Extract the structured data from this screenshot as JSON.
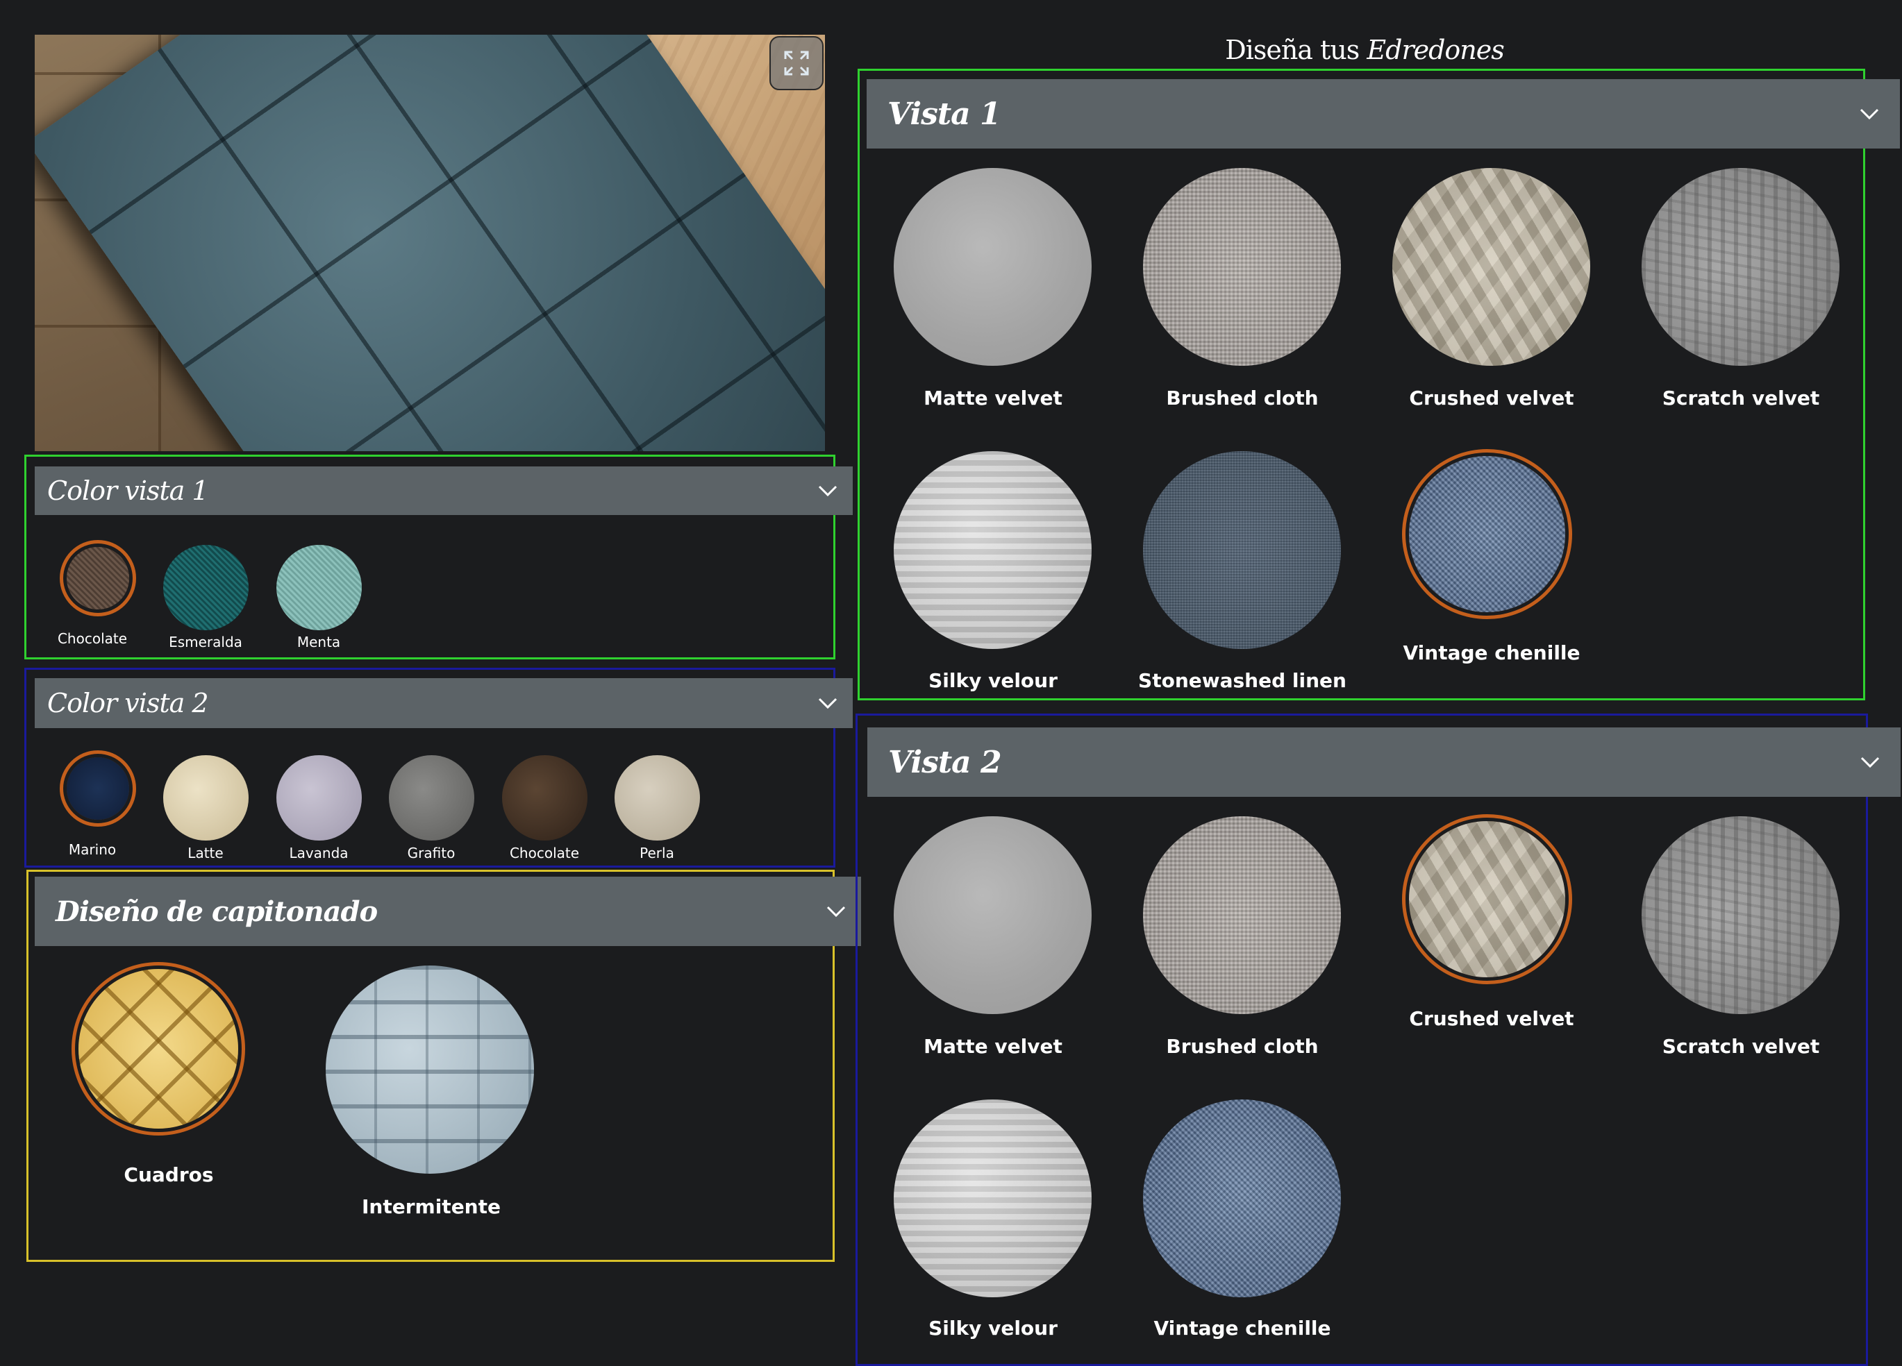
{
  "page": {
    "title_prefix": "Diseña tus",
    "title_emph": "Edredones"
  },
  "preview": {
    "expand_icon": "expand-icon"
  },
  "color_vista1": {
    "title": "Color vista 1",
    "options": [
      {
        "label": "Chocolate",
        "selected": true
      },
      {
        "label": "Esmeralda",
        "selected": false
      },
      {
        "label": "Menta",
        "selected": false
      }
    ]
  },
  "color_vista2": {
    "title": "Color vista 2",
    "options": [
      {
        "label": "Marino",
        "selected": true
      },
      {
        "label": "Latte",
        "selected": false
      },
      {
        "label": "Lavanda",
        "selected": false
      },
      {
        "label": "Grafito",
        "selected": false
      },
      {
        "label": "Chocolate",
        "selected": false
      },
      {
        "label": "Perla",
        "selected": false
      }
    ]
  },
  "capitonado": {
    "title": "Diseño de capitonado",
    "options": [
      {
        "label": "Cuadros",
        "selected": true
      },
      {
        "label": "Intermitente",
        "selected": false
      }
    ]
  },
  "vista1": {
    "title": "Vista 1",
    "options": [
      {
        "label": "Matte velvet",
        "selected": false
      },
      {
        "label": "Brushed cloth",
        "selected": false
      },
      {
        "label": "Crushed velvet",
        "selected": false
      },
      {
        "label": "Scratch velvet",
        "selected": false
      },
      {
        "label": "Silky velour",
        "selected": false
      },
      {
        "label": "Stonewashed linen",
        "selected": false
      },
      {
        "label": "Vintage chenille",
        "selected": true
      }
    ]
  },
  "vista2": {
    "title": "Vista 2",
    "options": [
      {
        "label": "Matte velvet",
        "selected": false
      },
      {
        "label": "Brushed cloth",
        "selected": false
      },
      {
        "label": "Crushed velvet",
        "selected": true
      },
      {
        "label": "Scratch velvet",
        "selected": false
      },
      {
        "label": "Silky velour",
        "selected": false
      },
      {
        "label": "Vintage chenille",
        "selected": false
      }
    ]
  },
  "colors": {
    "accent_selected": "#c45f1c",
    "header_bg": "#5c6367",
    "page_bg": "#1b1c1e"
  }
}
